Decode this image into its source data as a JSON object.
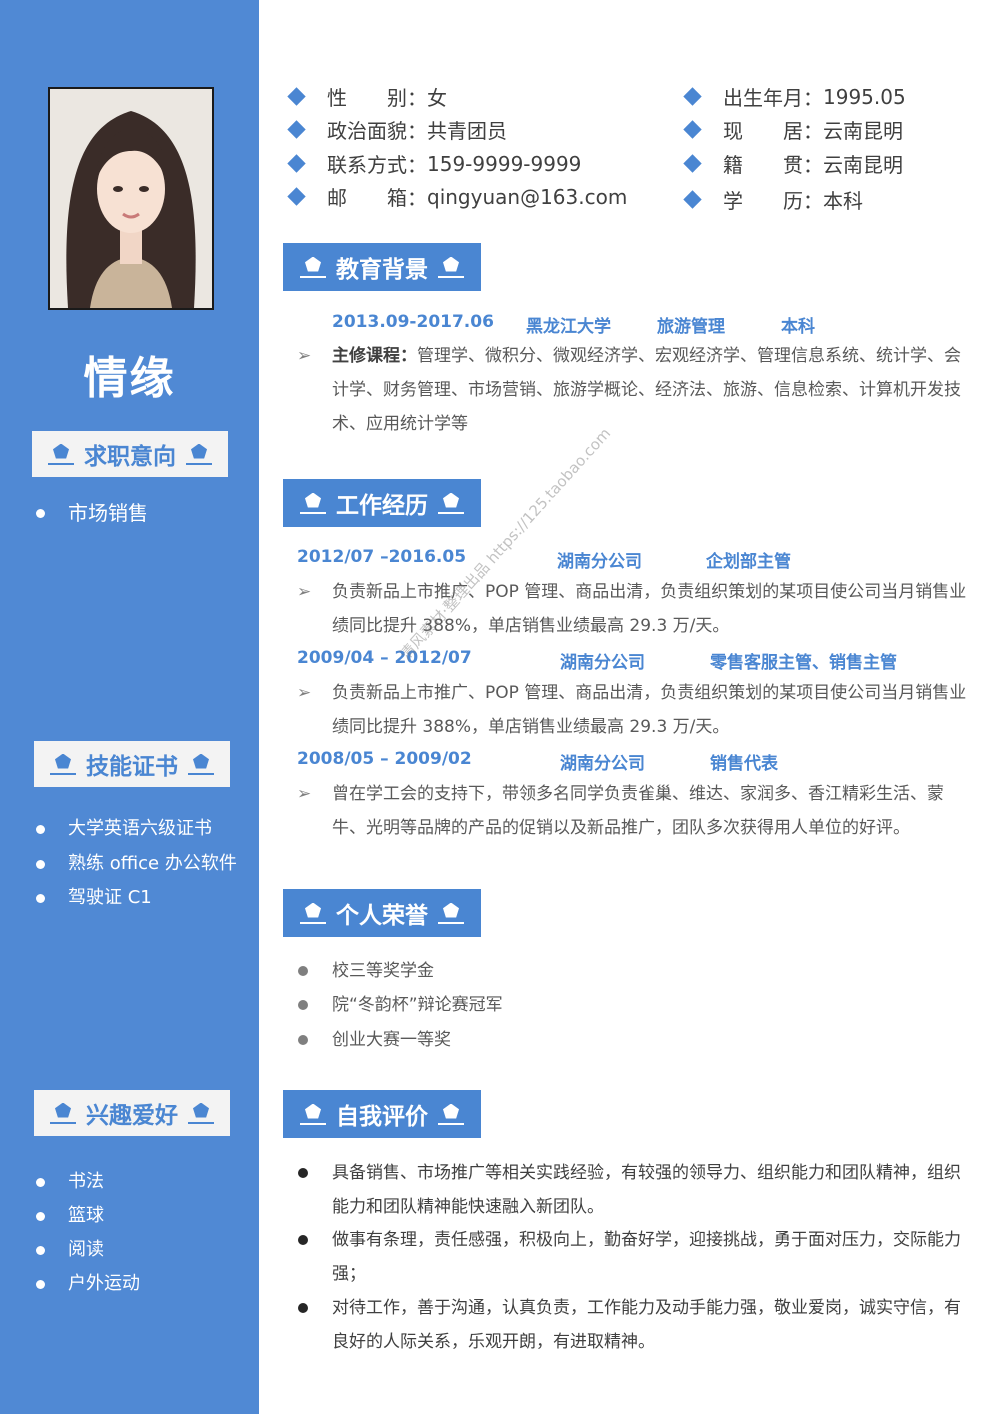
{
  "profile": {
    "name": "情缘",
    "photo_alt": "证件照"
  },
  "sidebar": {
    "intent": {
      "title": "求职意向",
      "items": [
        "市场销售"
      ]
    },
    "skills": {
      "title": "技能证书",
      "items": [
        "大学英语六级证书",
        "熟练 office 办公软件",
        "驾驶证 C1"
      ]
    },
    "hobbies": {
      "title": "兴趣爱好",
      "items": [
        "书法",
        "篮球",
        "阅读",
        "户外运动"
      ]
    }
  },
  "basic_info": [
    {
      "label": "性　　别",
      "value": "女"
    },
    {
      "label": "出生年月",
      "value": "1995.05"
    },
    {
      "label": "政治面貌",
      "value": "共青团员"
    },
    {
      "label": "现　　居",
      "value": "云南昆明"
    },
    {
      "label": "联系方式",
      "value": "159-9999-9999"
    },
    {
      "label": "籍　　贯",
      "value": "云南昆明"
    },
    {
      "label": "邮　　箱",
      "value": "qingyuan@163.com"
    },
    {
      "label": "学　　历",
      "value": "本科"
    }
  ],
  "education": {
    "title": "教育背景",
    "period": "2013.09-2017.06",
    "school": "黑龙江大学",
    "major": "旅游管理",
    "degree": "本科",
    "courses_label": "主修课程：",
    "courses": "管理学、微积分、微观经济学、宏观经济学、管理信息系统、统计学、会计学、财务管理、市场营销、旅游学概论、经济法、旅游、信息检索、计算机开发技术、应用统计学等"
  },
  "work": {
    "title": "工作经历",
    "jobs": [
      {
        "period": "2012/07 –2016.05",
        "company": "湖南分公司",
        "role": "企划部主管",
        "desc": "负责新品上市推广、POP 管理、商品出清，负责组织策划的某项目使公司当月销售业绩同比提升 388%，单店销售业绩最高 29.3 万/天。"
      },
      {
        "period": "2009/04 – 2012/07",
        "company": "湖南分公司",
        "role": "零售客服主管、销售主管",
        "desc": "负责新品上市推广、POP 管理、商品出清，负责组织策划的某项目使公司当月销售业绩同比提升 388%，单店销售业绩最高 29.3 万/天。"
      },
      {
        "period": "2008/05 – 2009/02",
        "company": "湖南分公司",
        "role": "销售代表",
        "desc": "曾在学工会的支持下，带领多名同学负责雀巢、维达、家润多、香江精彩生活、蒙牛、光明等品牌的产品的促销以及新品推广，团队多次获得用人单位的好评。"
      }
    ]
  },
  "honors": {
    "title": "个人荣誉",
    "items": [
      "校三等奖学金",
      "院“冬韵杯”辩论赛冠军",
      "创业大赛一等奖"
    ]
  },
  "self_eval": {
    "title": "自我评价",
    "items": [
      "具备销售、市场推广等相关实践经验，有较强的领导力、组织能力和团队精神，组织能力和团队精神能快速融入新团队。",
      "做事有条理，责任感强，积极向上，勤奋好学，迎接挑战，勇于面对压力，交际能力强；",
      "对待工作，善于沟通，认真负责，工作能力及动手能力强，敬业爱岗，诚实守信，有良好的人际关系，乐观开朗，有进取精神。"
    ]
  },
  "watermark": "清风素材·整理出品 https://125.taobao.com",
  "colors": {
    "accent": "#4a86d2",
    "sidebar": "#5089d4",
    "text": "#595959"
  }
}
